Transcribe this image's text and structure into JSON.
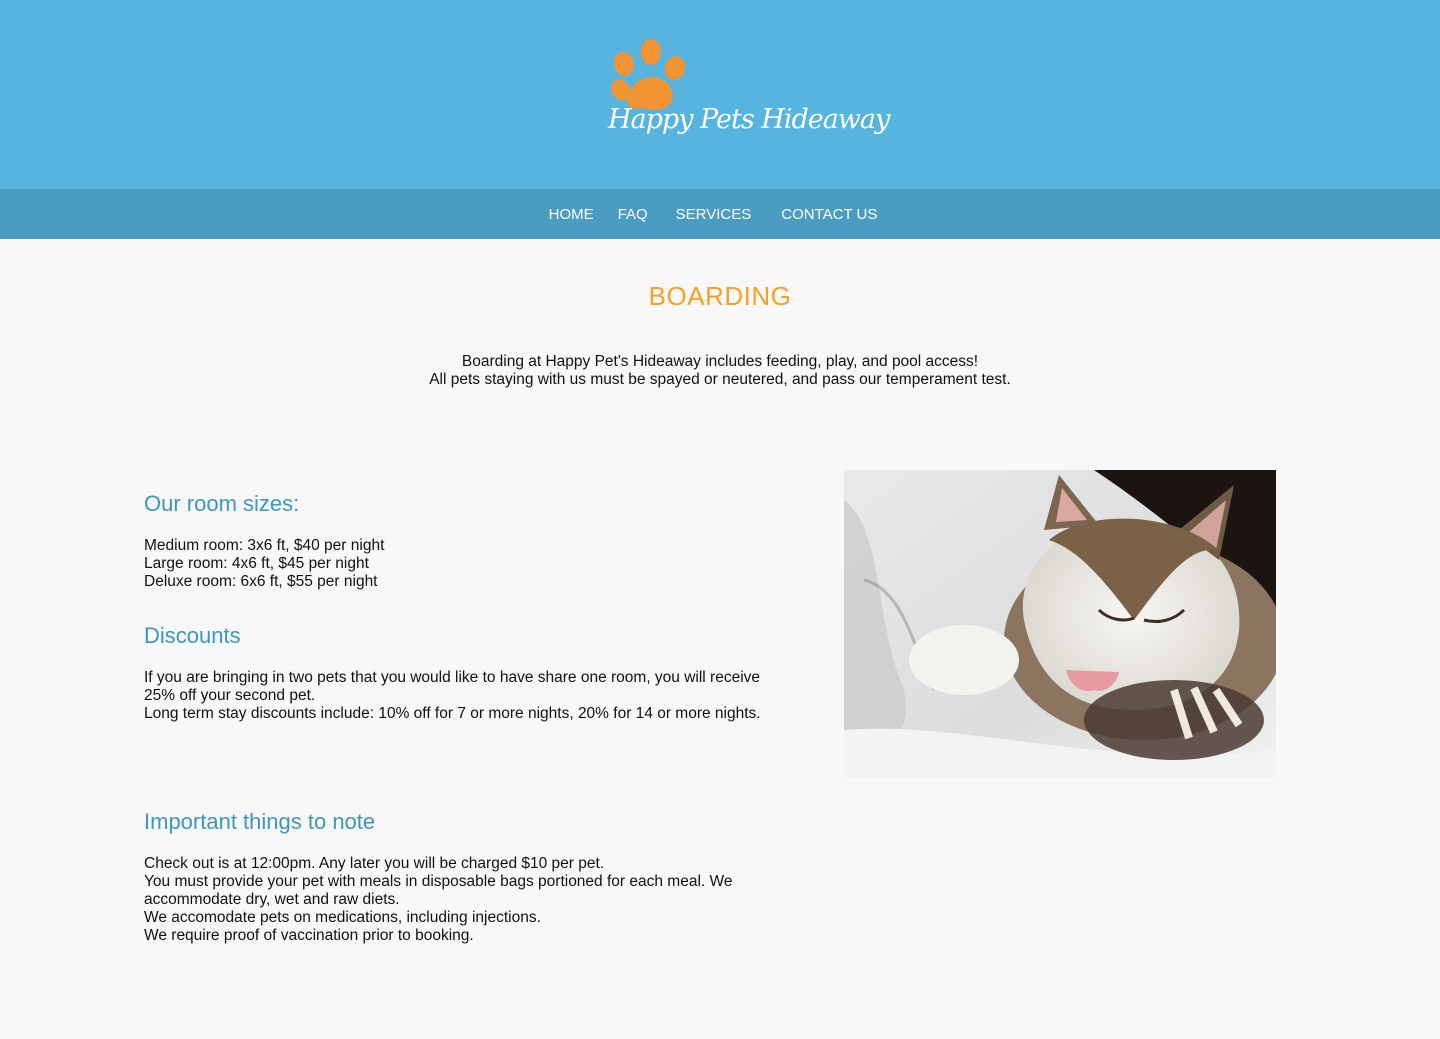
{
  "brand": {
    "name": "Happy Pets Hideaway",
    "logo_icon": "paw-print-icon",
    "colors": {
      "header": "#56b4df",
      "nav": "#4a9cc2",
      "accent": "#f5a128",
      "heading": "#3d96c0",
      "paw": "#f39434"
    }
  },
  "nav": {
    "items": [
      "HOME",
      "FAQ",
      "SERVICES",
      "CONTACT US"
    ]
  },
  "page": {
    "title": "BOARDING",
    "intro_line1": "Boarding at Happy Pet's Hideaway includes feeding, play, and pool access!",
    "intro_line2": "All pets staying with us must be spayed or neutered, and pass our temperament test."
  },
  "rooms": {
    "heading": "Our room sizes:",
    "lines": [
      "Medium room: 3x6 ft, $40 per night",
      "Large room: 4x6 ft, $45 per night",
      "Deluxe room: 6x6 ft, $55 per night"
    ]
  },
  "discounts": {
    "heading": "Discounts",
    "lines": [
      "If you are bringing in two pets that you would like to have share one room, you will receive 25% off your second pet.",
      "Long term stay discounts include: 10% off for 7 or more nights, 20% for 14 or more nights."
    ]
  },
  "notes": {
    "heading": "Important things to note",
    "lines": [
      "Check out is at 12:00pm. Any later you will be charged $10 per pet.",
      "You must provide your pet with meals in disposable bags portioned for each meal. We accommodate dry, wet and raw diets.",
      "We accomodate pets on medications, including injections.",
      "We require proof of vaccination prior to booking."
    ]
  },
  "photo": {
    "subject": "sleeping-cat-image"
  }
}
